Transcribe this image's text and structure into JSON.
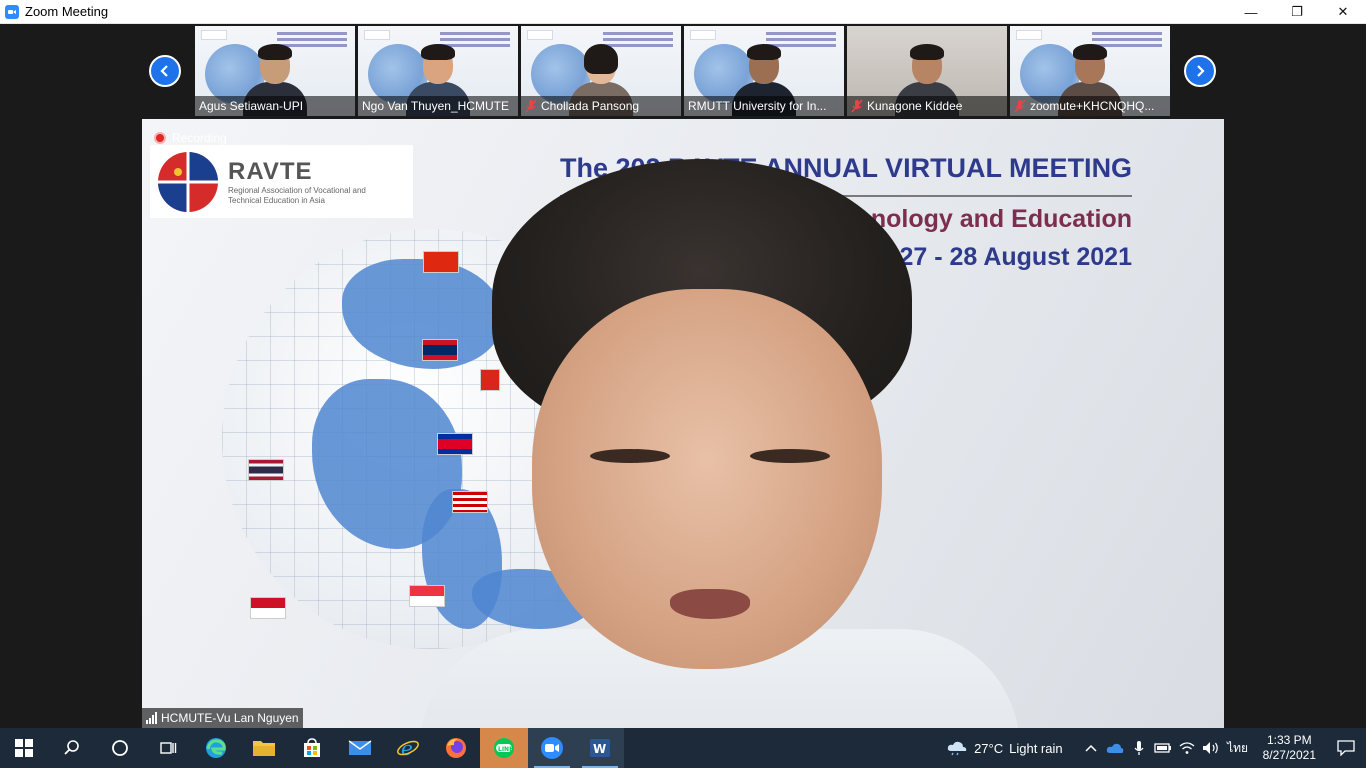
{
  "window": {
    "title": "Zoom Meeting",
    "minimize": "—",
    "restore": "❐",
    "close": "✕"
  },
  "gallery": {
    "participants": [
      {
        "name": "Agus Setiawan-UPI",
        "muted": false
      },
      {
        "name": "Ngo Van Thuyen_HCMUTE",
        "muted": false
      },
      {
        "name": "Chollada Pansong",
        "muted": true
      },
      {
        "name": "RMUTT University for In...",
        "muted": false
      },
      {
        "name": "Kunagone Kiddee",
        "muted": true
      },
      {
        "name": "zoomute+KHCNQHQ...",
        "muted": true
      }
    ]
  },
  "main": {
    "recording_label": "Recording",
    "slide": {
      "logo_name": "RAVTE",
      "logo_sub": "Regional Association of Vocational and Technical Education in Asia",
      "title": "The 202   RAVTE ANNUAL VIRTUAL MEETING",
      "subtitle": "chnology and Education",
      "date": "27 - 28 August 2021"
    },
    "speaker_name": "HCMUTE-Vu Lan Nguyen"
  },
  "taskbar": {
    "weather_temp": "27°C",
    "weather_desc": "Light rain",
    "lang": "ไทย",
    "time": "1:33 PM",
    "date": "8/27/2021",
    "colors": {
      "bg": "#1c2a3a",
      "accent": "#2d8cff"
    }
  }
}
